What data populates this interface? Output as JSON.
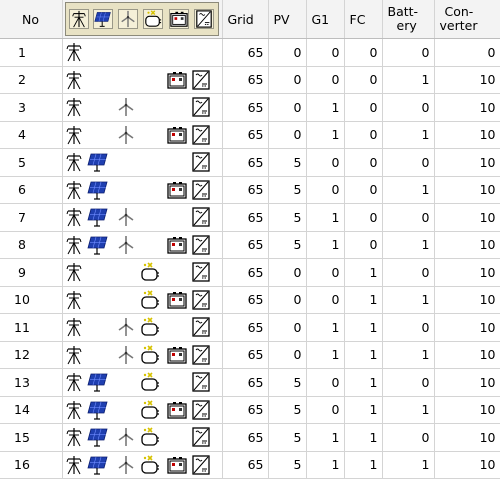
{
  "columns": {
    "no": "No",
    "grid": "Grid",
    "pv": "PV",
    "g1": "G1",
    "fc": "FC",
    "battery": [
      "Batt-",
      "ery"
    ],
    "converter": [
      "Con-",
      "verter"
    ]
  },
  "header_icons": [
    "grid-tower-icon",
    "solar-panel-icon",
    "wind-turbine-icon",
    "fuel-cell-icon",
    "battery-icon",
    "converter-icon"
  ],
  "rows": [
    {
      "no": "1",
      "grid": "65",
      "pv": "0",
      "g1": "0",
      "fc": "0",
      "battery": "0",
      "converter": "0",
      "icons": {
        "grid": true,
        "pv": false,
        "wind": false,
        "fc": false,
        "bat": false,
        "conv": false
      }
    },
    {
      "no": "2",
      "grid": "65",
      "pv": "0",
      "g1": "0",
      "fc": "0",
      "battery": "1",
      "converter": "10",
      "icons": {
        "grid": true,
        "pv": false,
        "wind": false,
        "fc": false,
        "bat": true,
        "conv": true
      }
    },
    {
      "no": "3",
      "grid": "65",
      "pv": "0",
      "g1": "1",
      "fc": "0",
      "battery": "0",
      "converter": "10",
      "icons": {
        "grid": true,
        "pv": false,
        "wind": true,
        "fc": false,
        "bat": false,
        "conv": true
      }
    },
    {
      "no": "4",
      "grid": "65",
      "pv": "0",
      "g1": "1",
      "fc": "0",
      "battery": "1",
      "converter": "10",
      "icons": {
        "grid": true,
        "pv": false,
        "wind": true,
        "fc": false,
        "bat": true,
        "conv": true
      }
    },
    {
      "no": "5",
      "grid": "65",
      "pv": "5",
      "g1": "0",
      "fc": "0",
      "battery": "0",
      "converter": "10",
      "icons": {
        "grid": true,
        "pv": true,
        "wind": false,
        "fc": false,
        "bat": false,
        "conv": true
      }
    },
    {
      "no": "6",
      "grid": "65",
      "pv": "5",
      "g1": "0",
      "fc": "0",
      "battery": "1",
      "converter": "10",
      "icons": {
        "grid": true,
        "pv": true,
        "wind": false,
        "fc": false,
        "bat": true,
        "conv": true
      }
    },
    {
      "no": "7",
      "grid": "65",
      "pv": "5",
      "g1": "1",
      "fc": "0",
      "battery": "0",
      "converter": "10",
      "icons": {
        "grid": true,
        "pv": true,
        "wind": true,
        "fc": false,
        "bat": false,
        "conv": true
      }
    },
    {
      "no": "8",
      "grid": "65",
      "pv": "5",
      "g1": "1",
      "fc": "0",
      "battery": "1",
      "converter": "10",
      "icons": {
        "grid": true,
        "pv": true,
        "wind": true,
        "fc": false,
        "bat": true,
        "conv": true
      }
    },
    {
      "no": "9",
      "grid": "65",
      "pv": "0",
      "g1": "0",
      "fc": "1",
      "battery": "0",
      "converter": "10",
      "icons": {
        "grid": true,
        "pv": false,
        "wind": false,
        "fc": true,
        "bat": false,
        "conv": true
      }
    },
    {
      "no": "10",
      "grid": "65",
      "pv": "0",
      "g1": "0",
      "fc": "1",
      "battery": "1",
      "converter": "10",
      "icons": {
        "grid": true,
        "pv": false,
        "wind": false,
        "fc": true,
        "bat": true,
        "conv": true
      }
    },
    {
      "no": "11",
      "grid": "65",
      "pv": "0",
      "g1": "1",
      "fc": "1",
      "battery": "0",
      "converter": "10",
      "icons": {
        "grid": true,
        "pv": false,
        "wind": true,
        "fc": true,
        "bat": false,
        "conv": true
      }
    },
    {
      "no": "12",
      "grid": "65",
      "pv": "0",
      "g1": "1",
      "fc": "1",
      "battery": "1",
      "converter": "10",
      "icons": {
        "grid": true,
        "pv": false,
        "wind": true,
        "fc": true,
        "bat": true,
        "conv": true
      }
    },
    {
      "no": "13",
      "grid": "65",
      "pv": "5",
      "g1": "0",
      "fc": "1",
      "battery": "0",
      "converter": "10",
      "icons": {
        "grid": true,
        "pv": true,
        "wind": false,
        "fc": true,
        "bat": false,
        "conv": true
      }
    },
    {
      "no": "14",
      "grid": "65",
      "pv": "5",
      "g1": "0",
      "fc": "1",
      "battery": "1",
      "converter": "10",
      "icons": {
        "grid": true,
        "pv": true,
        "wind": false,
        "fc": true,
        "bat": true,
        "conv": true
      }
    },
    {
      "no": "15",
      "grid": "65",
      "pv": "5",
      "g1": "1",
      "fc": "1",
      "battery": "0",
      "converter": "10",
      "icons": {
        "grid": true,
        "pv": true,
        "wind": true,
        "fc": true,
        "bat": false,
        "conv": true
      }
    },
    {
      "no": "16",
      "grid": "65",
      "pv": "5",
      "g1": "1",
      "fc": "1",
      "battery": "1",
      "converter": "10",
      "icons": {
        "grid": true,
        "pv": true,
        "wind": true,
        "fc": true,
        "bat": true,
        "conv": true
      }
    }
  ],
  "colors": {
    "pv_blue": "#1f3fb0",
    "header_bg": "#f3f3f3",
    "icon_header_bg": "#e8e2c4",
    "grid_line": "#d4d4d4"
  }
}
